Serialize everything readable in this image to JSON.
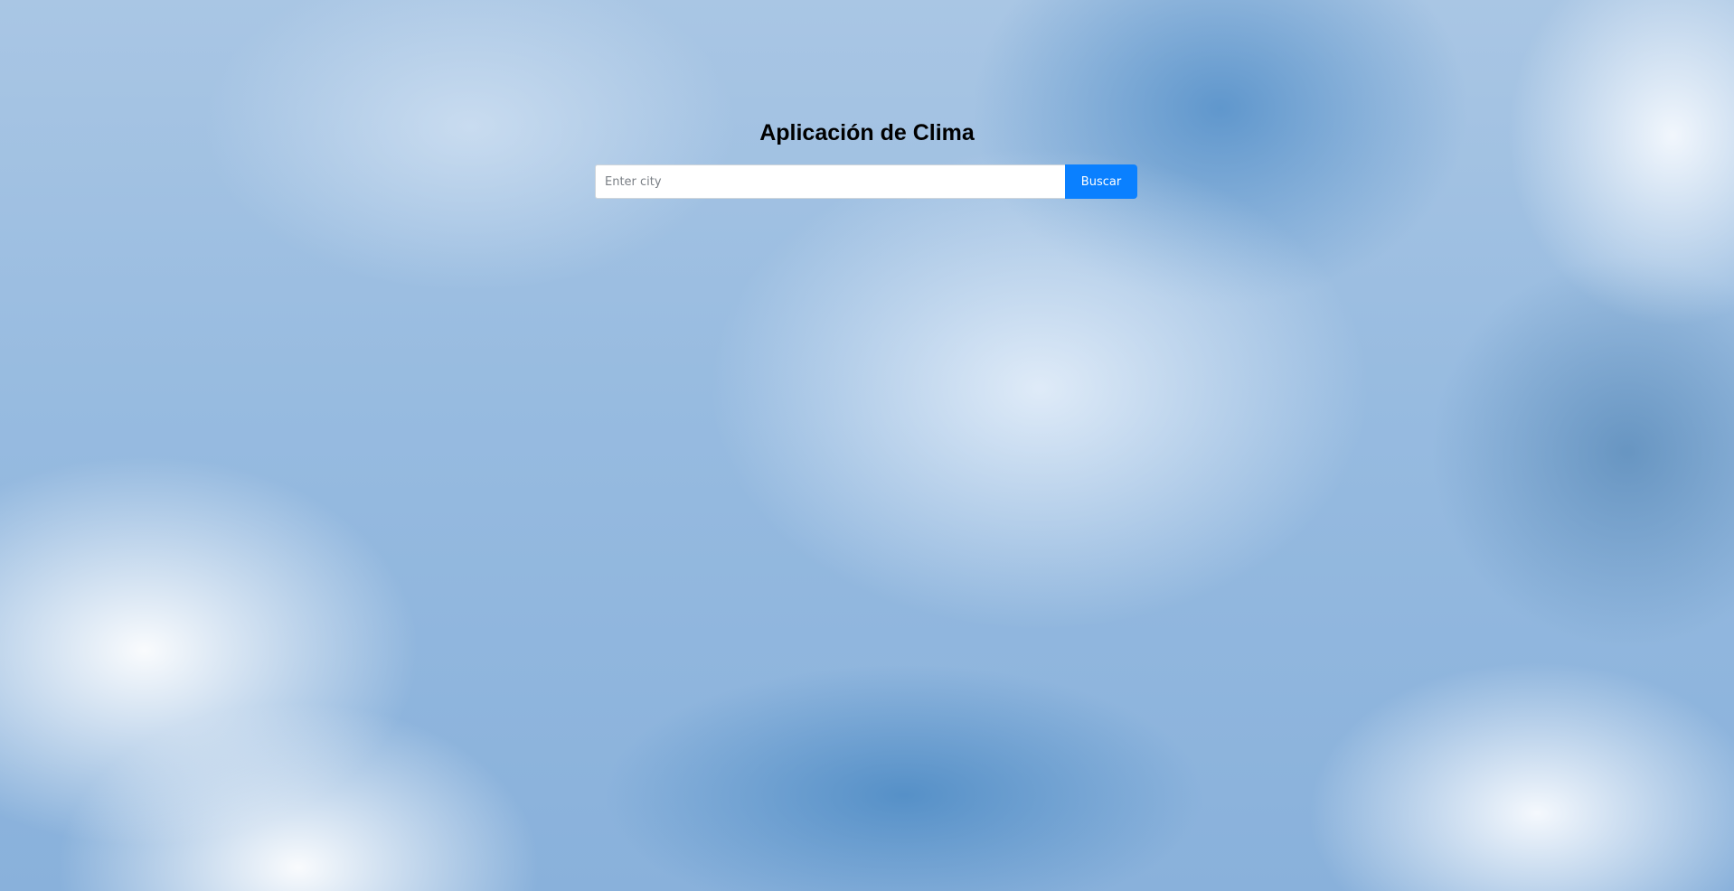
{
  "app": {
    "title": "Aplicación de Clima"
  },
  "search": {
    "placeholder": "Enter city",
    "value": "",
    "button_label": "Buscar"
  },
  "colors": {
    "button_bg": "#0a80ff",
    "button_text": "#ffffff",
    "title_text": "#000000"
  }
}
